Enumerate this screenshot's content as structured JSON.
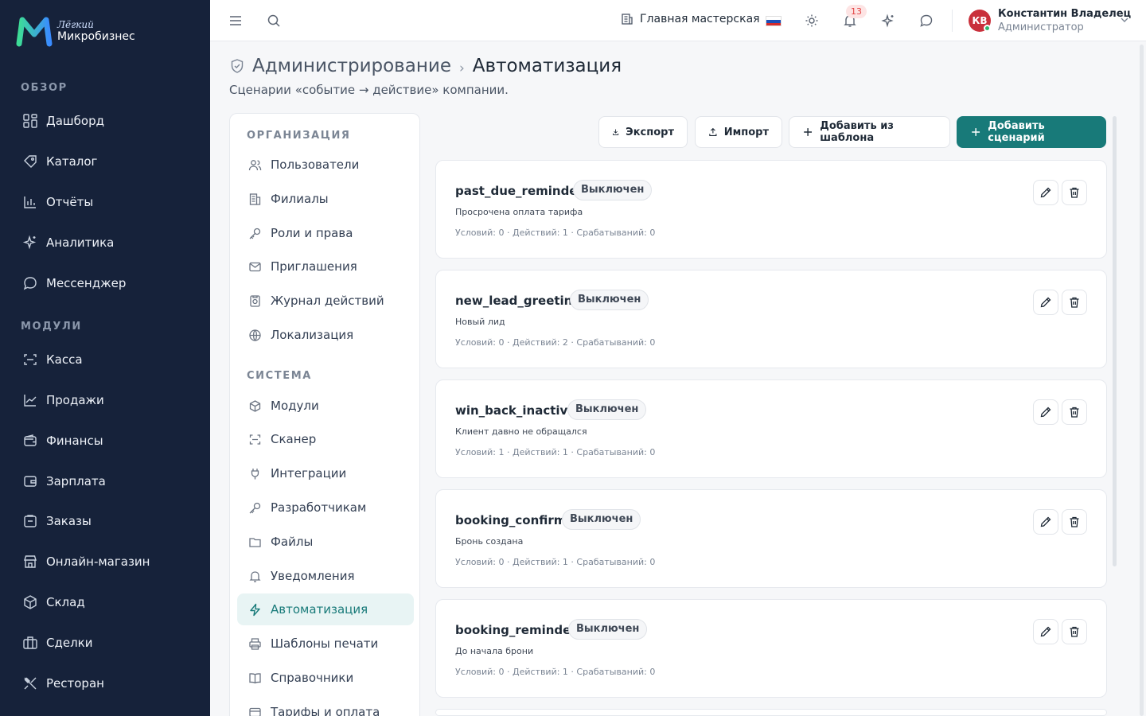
{
  "brand": {
    "small": "Лёгкий",
    "big": "Микробизнес",
    "colors": {
      "sidebar": "#16223a",
      "accent": "#187a79",
      "logo_left": "#3ddc97",
      "logo_right": "#3a8cff"
    }
  },
  "sidebar": {
    "section_overview": "ОБЗОР",
    "section_modules": "МОДУЛИ",
    "items": [
      {
        "label": "Дашборд",
        "icon": "dashboard-icon"
      },
      {
        "label": "Каталог",
        "icon": "catalog-icon"
      },
      {
        "label": "Отчёты",
        "icon": "reports-icon"
      },
      {
        "label": "Аналитика",
        "icon": "sparkles-icon"
      },
      {
        "label": "Мессенджер",
        "icon": "chat-icon"
      },
      {
        "label": "Касса",
        "icon": "scan-icon"
      },
      {
        "label": "Продажи",
        "icon": "trend-icon"
      },
      {
        "label": "Финансы",
        "icon": "wallet-icon"
      },
      {
        "label": "Зарплата",
        "icon": "wallet-icon"
      },
      {
        "label": "Заказы",
        "icon": "clipboard-icon"
      },
      {
        "label": "Онлайн-магазин",
        "icon": "store-icon"
      },
      {
        "label": "Склад",
        "icon": "box-icon"
      },
      {
        "label": "Сделки",
        "icon": "briefcase-icon"
      },
      {
        "label": "Ресторан",
        "icon": "utensils-icon"
      }
    ]
  },
  "topbar": {
    "workshop": "Главная мастерская",
    "notifications_count": "13",
    "user_initials": "КВ",
    "user_name": "Константин Владелец",
    "user_role": "Администратор"
  },
  "page": {
    "breadcrumb_parent": "Администрирование",
    "breadcrumb_sep": "›",
    "title": "Автоматизация",
    "subtitle": "Сценарии «событие → действие» компании."
  },
  "settings_nav": {
    "section_org": "ОРГАНИЗАЦИЯ",
    "section_system": "СИСТЕМА",
    "org_items": [
      "Пользователи",
      "Филиалы",
      "Роли и права",
      "Приглашения",
      "Журнал действий",
      "Локализация"
    ],
    "system_items": [
      "Модули",
      "Сканер",
      "Интеграции",
      "Разработчикам",
      "Файлы",
      "Уведомления",
      "Автоматизация",
      "Шаблоны печати",
      "Справочники",
      "Тарифы и оплата"
    ],
    "active": "Автоматизация"
  },
  "toolbar": {
    "export_label": "Экспорт",
    "import_label": "Импорт",
    "template_label": "Добавить из шаблона",
    "add_label": "Добавить сценарий"
  },
  "scenarios": [
    {
      "name": "past_due_reminder",
      "status": "Выключен",
      "description": "Просрочена оплата тарифа",
      "meta": "Условий: 0 · Действий: 1 · Срабатываний: 0"
    },
    {
      "name": "new_lead_greeting",
      "status": "Выключен",
      "description": "Новый лид",
      "meta": "Условий: 0 · Действий: 2 · Срабатываний: 0"
    },
    {
      "name": "win_back_inactive",
      "status": "Выключен",
      "description": "Клиент давно не обращался",
      "meta": "Условий: 1 · Действий: 1 · Срабатываний: 0"
    },
    {
      "name": "booking_confirm",
      "status": "Выключен",
      "description": "Бронь создана",
      "meta": "Условий: 0 · Действий: 1 · Срабатываний: 0"
    },
    {
      "name": "booking_reminder",
      "status": "Выключен",
      "description": "До начала брони",
      "meta": "Условий: 0 · Действий: 1 · Срабатываний: 0"
    }
  ]
}
